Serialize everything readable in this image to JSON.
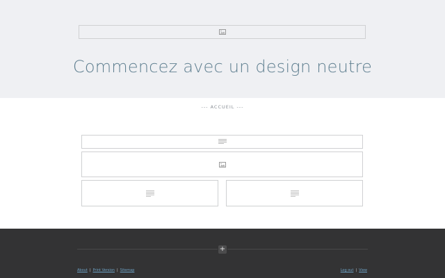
{
  "hero": {
    "title": "Commencez avec un design neutre",
    "image_icon": "image-icon"
  },
  "nav": {
    "label": "--- ACCUEIL ---"
  },
  "content": {
    "text_icon": "text-lines-icon",
    "image_icon": "image-icon"
  },
  "footer": {
    "plus": "+",
    "links_left": [
      {
        "label": "About"
      },
      {
        "label": "Print Version"
      },
      {
        "label": "Sitemap"
      }
    ],
    "links_right": [
      {
        "label": "Log out"
      },
      {
        "label": "View"
      }
    ],
    "separator": "|"
  },
  "colors": {
    "header_bg": "#eff0f3",
    "title_color": "#5f7f90",
    "footer_bg": "#333334",
    "link_color": "#6ea3c6"
  }
}
